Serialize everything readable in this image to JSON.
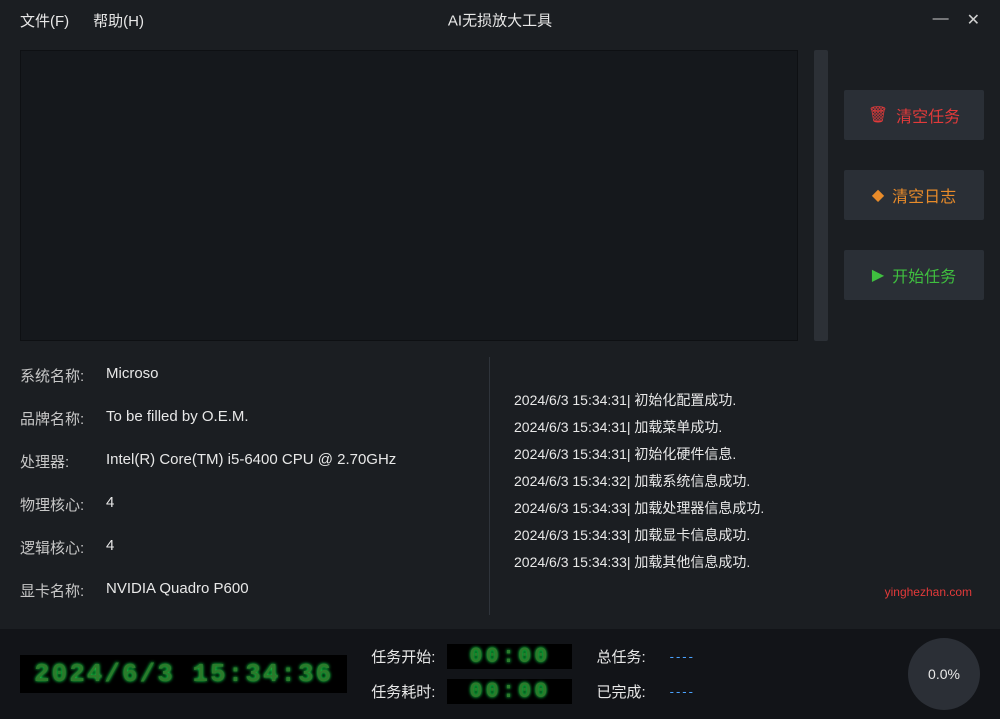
{
  "menu": {
    "file": "文件(F)",
    "help": "帮助(H)"
  },
  "window": {
    "title": "AI无损放大工具"
  },
  "buttons": {
    "clear_task": "清空任务",
    "clear_log": "清空日志",
    "start_task": "开始任务"
  },
  "sysinfo": {
    "labels": {
      "os": "系统名称:",
      "brand": "品牌名称:",
      "cpu": "处理器:",
      "phys_cores": "物理核心:",
      "log_cores": "逻辑核心:",
      "gpu": "显卡名称:"
    },
    "values": {
      "os": "Microso",
      "brand": "To be filled by O.E.M.",
      "cpu": "Intel(R) Core(TM) i5-6400 CPU @ 2.70GHz",
      "phys_cores": "4",
      "log_cores": "4",
      "gpu": "NVIDIA Quadro P600"
    }
  },
  "log": [
    "2024/6/3 15:34:31| 初始化配置成功.",
    "2024/6/3 15:34:31| 加载菜单成功.",
    "2024/6/3 15:34:31| 初始化硬件信息.",
    "2024/6/3 15:34:32| 加载系统信息成功.",
    "2024/6/3 15:34:33| 加载处理器信息成功.",
    "2024/6/3 15:34:33| 加载显卡信息成功.",
    "2024/6/3 15:34:33| 加载其他信息成功."
  ],
  "watermark": "yinghezhan.com",
  "status": {
    "clock": "2024/6/3 15:34:36",
    "task_start_label": "任务开始:",
    "task_start": "00:00",
    "task_elapsed_label": "任务耗时:",
    "task_elapsed": "00:00",
    "total_label": "总任务:",
    "total_value": "----",
    "done_label": "已完成:",
    "done_value": "----",
    "progress": "0.0%"
  }
}
